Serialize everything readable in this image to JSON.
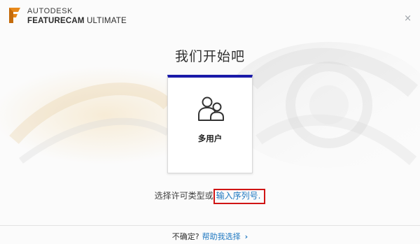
{
  "app": {
    "vendor": "AUTODESK",
    "product_bold": "FEATURECAM",
    "product_edition": " ULTIMATE",
    "close_glyph": "×"
  },
  "main": {
    "title": "我们开始吧",
    "card": {
      "label": "多用户",
      "icon": "multi-user-icon"
    },
    "license_prompt": "选择许可类型或",
    "serial_link": "输入序列号."
  },
  "footer": {
    "question": "不确定?",
    "help_link": "帮助我选择",
    "chevron": "›"
  },
  "colors": {
    "card_accent": "#1a1aa8",
    "link": "#1f78c1",
    "highlight_box": "#d01515",
    "logo_orange": "#e8891a"
  }
}
